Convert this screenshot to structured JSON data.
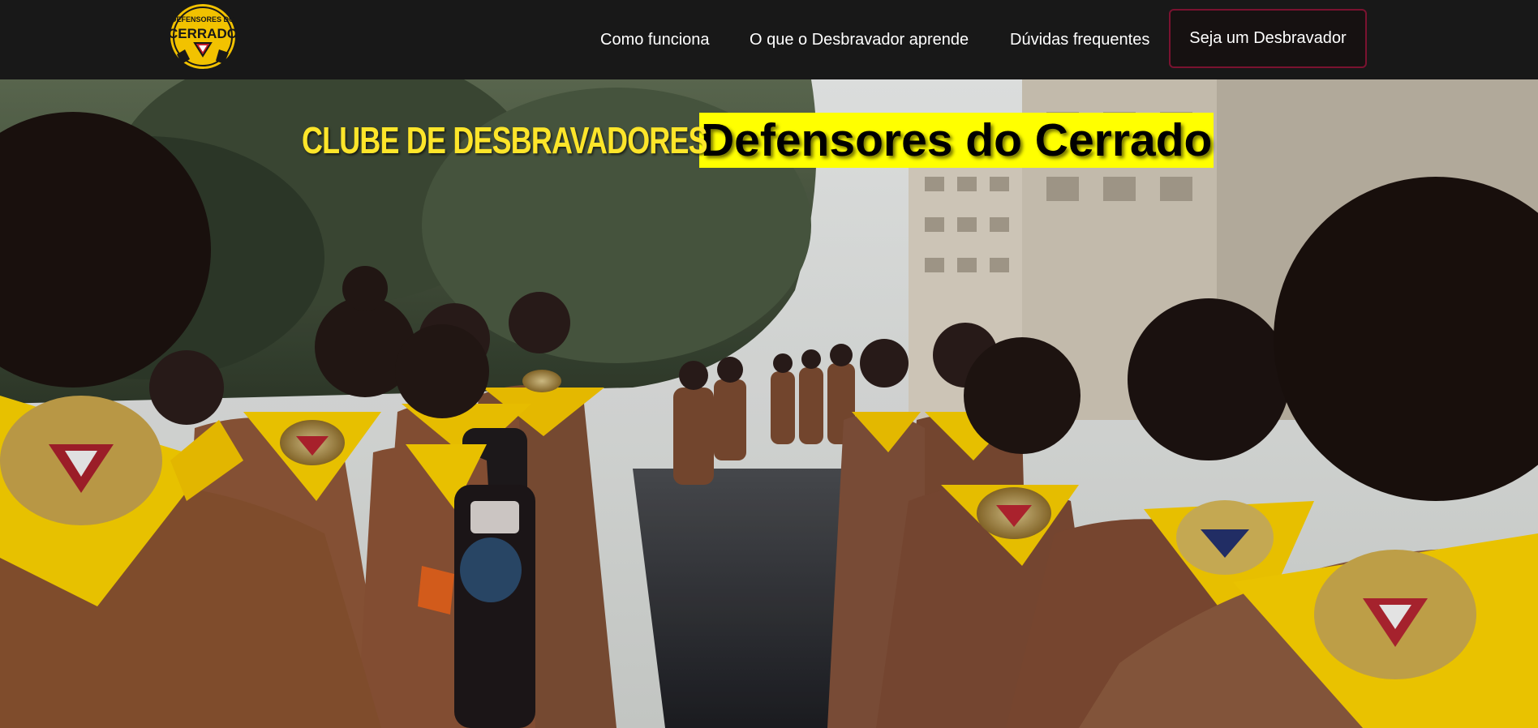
{
  "brand": {
    "logo_text_top": "DEFENSORES DO",
    "logo_text_main": "CERRADO"
  },
  "nav": {
    "items": [
      {
        "label": "Como funciona"
      },
      {
        "label": "O que o Desbravador aprende"
      },
      {
        "label": "Dúvidas frequentes"
      }
    ],
    "cta_label": "Seja um Desbravador"
  },
  "hero": {
    "headline_prefix": "CLUBE DE DESBRAVADORES",
    "headline_name": "Defensores do Cerrado",
    "image_alt": "Desbravadores marchando com lenços amarelos na chuva"
  },
  "colors": {
    "topbar": "#181818",
    "accent_yellow": "#ffff00",
    "headline_yellow": "#fde52a",
    "cta_border": "#7a1230",
    "uniform_brown": "#8a4a2c"
  }
}
